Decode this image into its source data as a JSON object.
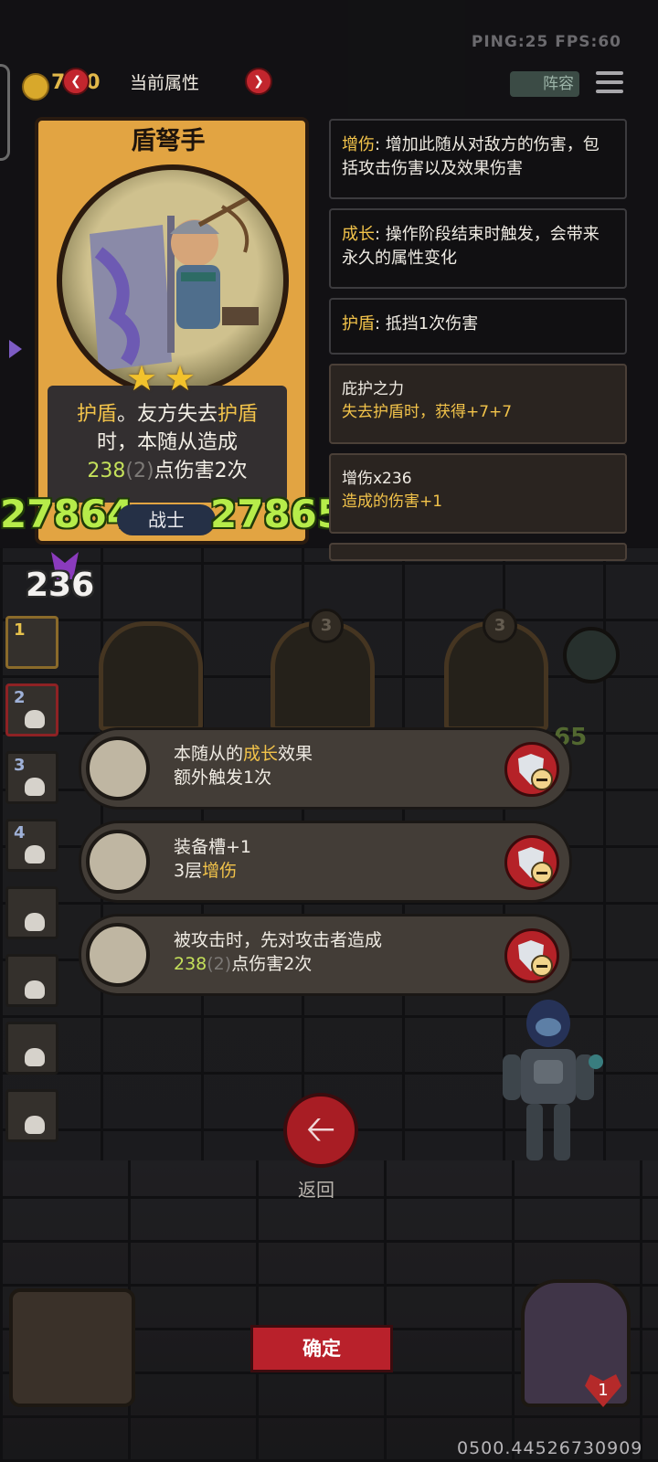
{
  "status": {
    "ping_fps": "PING:25   FPS:60"
  },
  "header": {
    "coins": "7 20",
    "title": "当前属性",
    "team_label": "阵容"
  },
  "card": {
    "name": "盾弩手",
    "stars": 2,
    "desc_line1_a": "护盾",
    "desc_line1_b": "。友方失去",
    "desc_line1_c": "护盾",
    "desc_line2": "时，本随从造成",
    "desc_line3_value": "238",
    "desc_line3_paren": "(2)",
    "desc_line3_tail": "点伤害2次",
    "attack": "27864",
    "health": "27865",
    "role": "战士"
  },
  "badge": {
    "value": "236"
  },
  "tooltips": [
    {
      "key": "增伤",
      "text": ": 增加此随从对敌方的伤害，包括攻击伤害以及效果伤害"
    },
    {
      "key": "成长",
      "text": ": 操作阶段结束时触发，会带来永久的属性变化"
    },
    {
      "key": "护盾",
      "text": ": 抵挡1次伤害"
    }
  ],
  "buffs": [
    {
      "title": "庇护之力",
      "line": "失去护盾时，获得+7+7"
    },
    {
      "title": "增伤x236",
      "line": "造成的伤害+1"
    }
  ],
  "left_list": [
    "1",
    "2",
    "3",
    "4",
    "",
    "",
    "",
    ""
  ],
  "board": {
    "star_values": [
      "3",
      "3"
    ],
    "partial_number": "65"
  },
  "equipment": [
    {
      "icon": "gauntlet-icon",
      "line1_a": "本随从的",
      "line1_b": "成长",
      "line1_c": "效果",
      "line2": "额外触发1次"
    },
    {
      "icon": "glove-icon",
      "line1_a": "装备槽+1",
      "line2_a": "3层",
      "line2_b": "增伤"
    },
    {
      "icon": "red-cloak-icon",
      "line1_a": "被攻击时，先对攻击者造成",
      "line2_value": "238",
      "line2_paren": "(2)",
      "line2_tail": "点伤害2次"
    }
  ],
  "back_label": "返回",
  "confirm_label": "确定",
  "lives": "1",
  "footer": "0500.44526730909",
  "colors": {
    "accent_red": "#b9212b",
    "keyword_yellow": "#f2c34a",
    "value_green": "#c4e05a"
  }
}
